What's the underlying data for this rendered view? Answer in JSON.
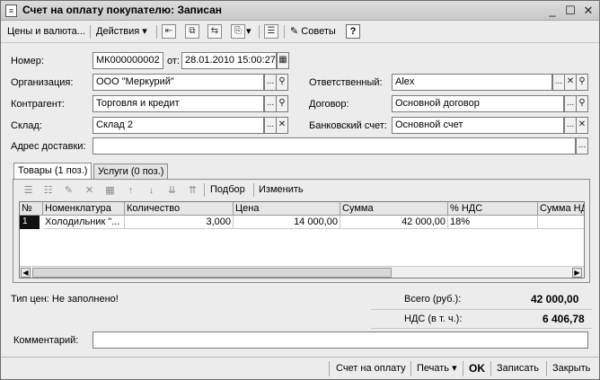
{
  "window": {
    "title": "Счет на оплату покупателю: Записан",
    "min_icon": "_",
    "max_icon": "☐",
    "close_icon": "✕"
  },
  "toolbar": {
    "prices_label": "Цены и валюта...",
    "actions_label": "Действия",
    "advice_label": "Советы",
    "help_label": "?"
  },
  "form": {
    "number_label": "Номер:",
    "number_value": "МК000000002",
    "from_label": "от:",
    "date_value": "28.01.2010 15:00:27",
    "org_label": "Организация:",
    "org_value": "ООО \"Меркурий\"",
    "responsible_label": "Ответственный:",
    "responsible_value": "Alex",
    "contractor_label": "Контрагент:",
    "contractor_value": "Торговля и кредит",
    "contract_label": "Договор:",
    "contract_value": "Основной договор",
    "warehouse_label": "Склад:",
    "warehouse_value": "Склад 2",
    "bank_label": "Банковский счет:",
    "bank_value": "Основной счет",
    "address_label": "Адрес доставки:",
    "address_value": "",
    "ellipsis": "...",
    "search_glyph": "🔍",
    "clear_glyph": "✕"
  },
  "tabs": [
    {
      "label": "Товары (1 поз.)"
    },
    {
      "label": "Услуги (0 поз.)"
    }
  ],
  "panel_toolbar": {
    "select_label": "Подбор",
    "change_label": "Изменить"
  },
  "table": {
    "headers": [
      "№",
      "Номенклатура",
      "Количество",
      "Цена",
      "Сумма",
      "% НДС",
      "Сумма НДС"
    ],
    "rows": [
      {
        "n": "1",
        "item": "Холодильник \"...",
        "qty": "3,000",
        "price": "14 000,00",
        "sum": "42 000,00",
        "vat_pct": "18%",
        "vat_sum": ""
      }
    ]
  },
  "totals": {
    "price_type": "Тип цен: Не заполнено!",
    "total_label": "Всего (руб.):",
    "total_value": "42 000,00",
    "vat_label": "НДС (в т. ч.):",
    "vat_value": "6 406,78"
  },
  "comment": {
    "label": "Комментарий:",
    "value": ""
  },
  "bottom": {
    "invoice_label": "Счет на оплату",
    "print_label": "Печать",
    "ok_label": "OK",
    "save_label": "Записать",
    "close_label": "Закрыть"
  }
}
